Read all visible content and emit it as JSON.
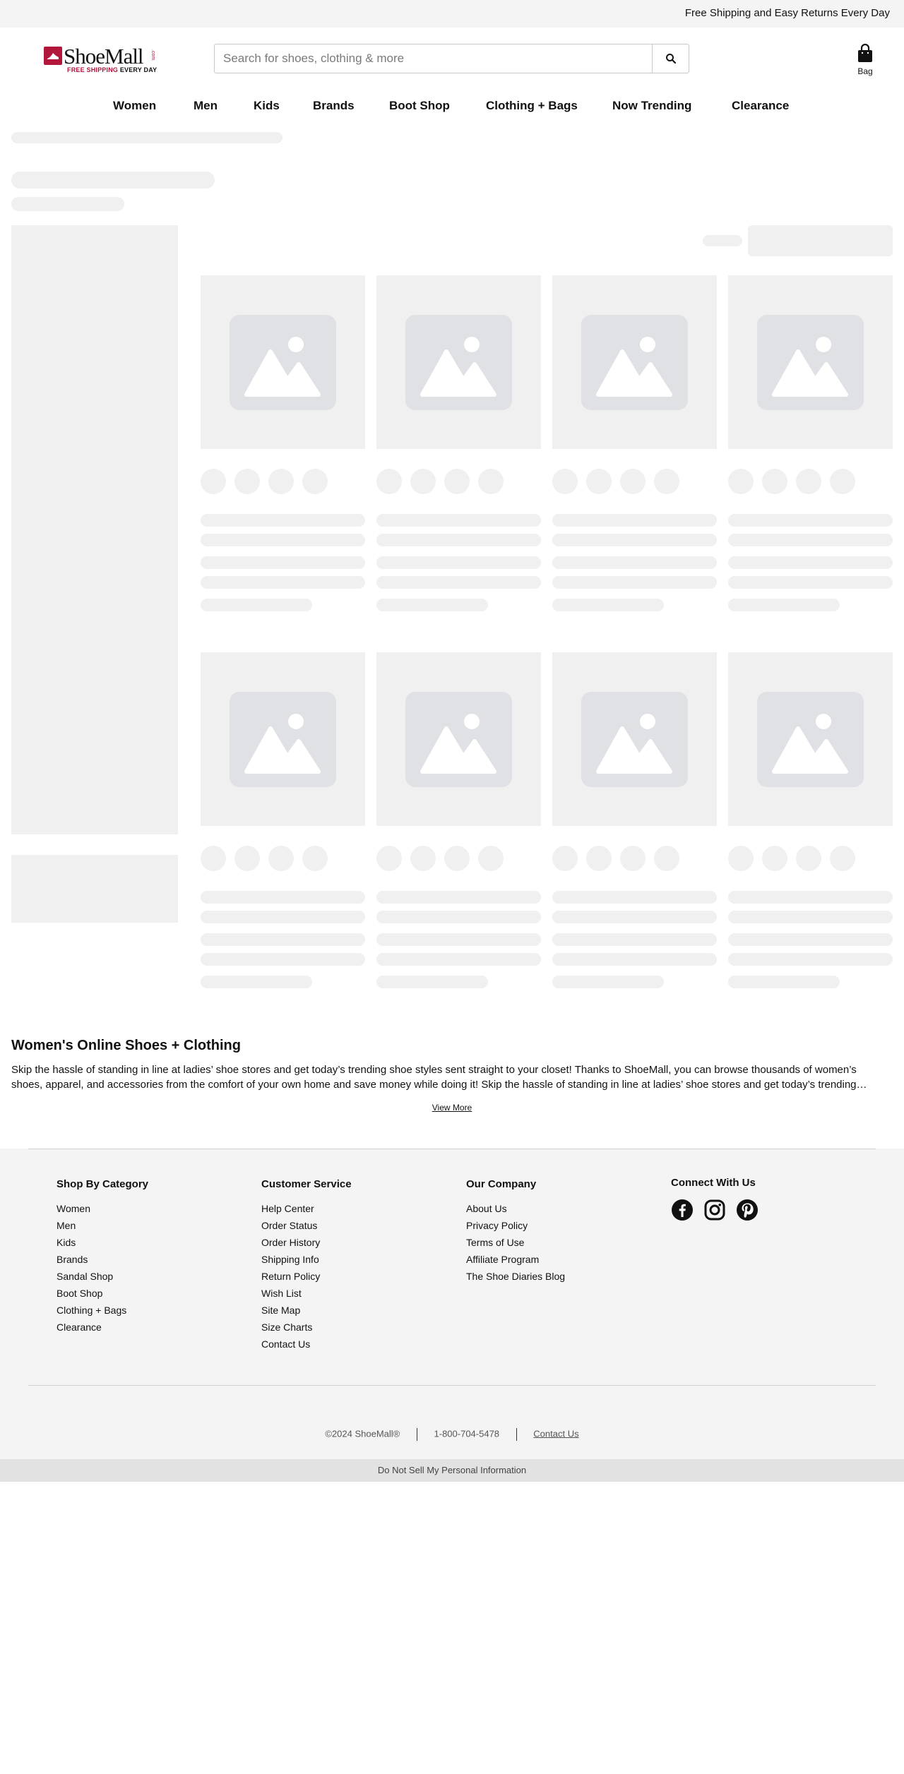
{
  "announcement": "Free Shipping and Easy Returns Every Day",
  "logo": {
    "brand": "ShoeMall",
    "tm": ".com",
    "tagline_red": "FREE SHIPPING",
    "tagline_dark": " EVERY DAY"
  },
  "search": {
    "placeholder": "Search for shoes, clothing & more",
    "icon": "search-icon"
  },
  "bag": {
    "label": "Bag",
    "icon": "shopping-bag-icon"
  },
  "nav": [
    "Women",
    "Men",
    "Kids",
    "Brands",
    "Boot Shop",
    "Clothing + Bags",
    "Now Trending",
    "Clearance"
  ],
  "seo": {
    "title": "Women's Online Shoes + Clothing",
    "text": "Skip the hassle of standing in line at ladies’ shoe stores and get today’s trending shoe styles sent straight to your closet! Thanks to ShoeMall, you can browse thousands of women’s shoes, apparel, and accessories from the comfort of your own home and save money while doing it! Skip the hassle of standing in line at ladies’ shoe stores and get today’s trending shoe styles sent straight to your closet!",
    "view_more": "View More"
  },
  "footer": {
    "shop_by_category": {
      "title": "Shop By Category",
      "links": [
        "Women",
        "Men",
        "Kids",
        "Brands",
        "Sandal Shop",
        "Boot Shop",
        "Clothing + Bags",
        "Clearance"
      ]
    },
    "customer_service": {
      "title": "Customer Service",
      "links": [
        "Help Center",
        "Order Status",
        "Order History",
        "Shipping Info",
        "Return Policy",
        "Wish List",
        "Site Map",
        "Size Charts",
        "Contact Us"
      ]
    },
    "our_company": {
      "title": "Our Company",
      "links": [
        "About Us",
        "Privacy Policy",
        "Terms of Use",
        "Affiliate Program",
        "The Shoe Diaries Blog"
      ]
    },
    "connect": {
      "title": "Connect With Us",
      "icons": [
        "facebook-icon",
        "instagram-icon",
        "pinterest-icon"
      ]
    },
    "copyright": "©2024 ShoeMall®",
    "phone": "1-800-704-5478",
    "contact": "Contact Us"
  },
  "do_not_sell": "Do Not Sell My Personal Information",
  "colors": {
    "brand_red": "#b3163b",
    "skeleton": "#f0f0f0",
    "placeholder_image": "#dfe1e4",
    "footer_bg": "#f4f4f4"
  }
}
